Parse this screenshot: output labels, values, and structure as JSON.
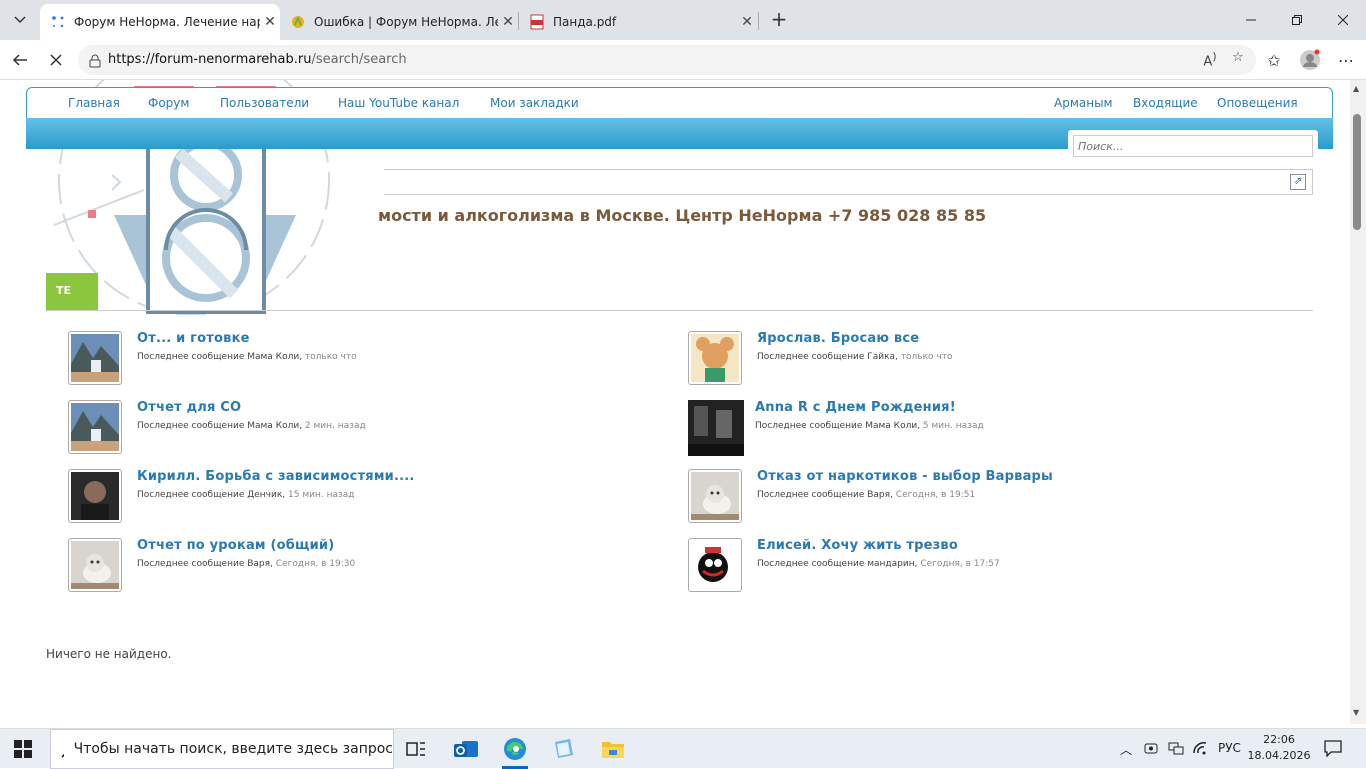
{
  "browser": {
    "tabs": [
      {
        "title": "Форум НеНорма. Лечение наркомании",
        "active": true
      },
      {
        "title": "Ошибка | Форум НеНорма. Лечение",
        "active": false
      },
      {
        "title": "Панда.pdf",
        "active": false
      }
    ],
    "url_host": "https://forum-nenormarehab.ru",
    "url_path": "/search/search"
  },
  "site": {
    "nav_left": [
      "Главная",
      "Форум",
      "Пользователи",
      "Наш YouTube канал",
      "Мои закладки"
    ],
    "nav_right": [
      "Арманым",
      "Входящие",
      "Оповещения"
    ],
    "search_placeholder": "Поиск...",
    "title": "мости и алкоголизма в Москве. Центр НеНорма +7 985 028 85 85",
    "green_tab": "ТЕ",
    "nothing_found": "Ничего не найдено."
  },
  "threads": [
    {
      "title": "От... и готовке",
      "author": "Мама Коли",
      "time": "только что",
      "avatar": "waterfall-icon"
    },
    {
      "title": "Ярослав. Бросаю все",
      "author": "Гайка",
      "time": "только что",
      "avatar": "mouse-cartoon-icon"
    },
    {
      "title": "Отчет для СО",
      "author": "Мама Коли",
      "time": "2 мин. назад",
      "avatar": "waterfall-icon"
    },
    {
      "title": "Anna R с Днем Рождения!",
      "author": "Мама Коли",
      "time": "5 мин. назад",
      "avatar": "bw-movie-icon"
    },
    {
      "title": "Кирилл. Борьба с зависимостями....",
      "author": "Денчик",
      "time": "15 мин. назад",
      "avatar": "dark-portrait-icon"
    },
    {
      "title": "Отказ от наркотиков - выбор Варвары",
      "author": "Варя",
      "time": "Сегодня, в 19:51",
      "avatar": "kitten-icon"
    },
    {
      "title": "Отчет по урокам (общий)",
      "author": "Варя",
      "time": "Сегодня, в 19:30",
      "avatar": "kitten-icon"
    },
    {
      "title": "Елисей. Хочу жить трезво",
      "author": "мандарин",
      "time": "Сегодня, в 17:57",
      "avatar": "smesharik-icon"
    }
  ],
  "labels": {
    "last_message": "Последнее сообщение"
  },
  "taskbar": {
    "search_text": "Чтобы начать поиск, введите здесь запрос",
    "lang": "РУС",
    "time": "22:06",
    "date": "18.04.2026"
  }
}
